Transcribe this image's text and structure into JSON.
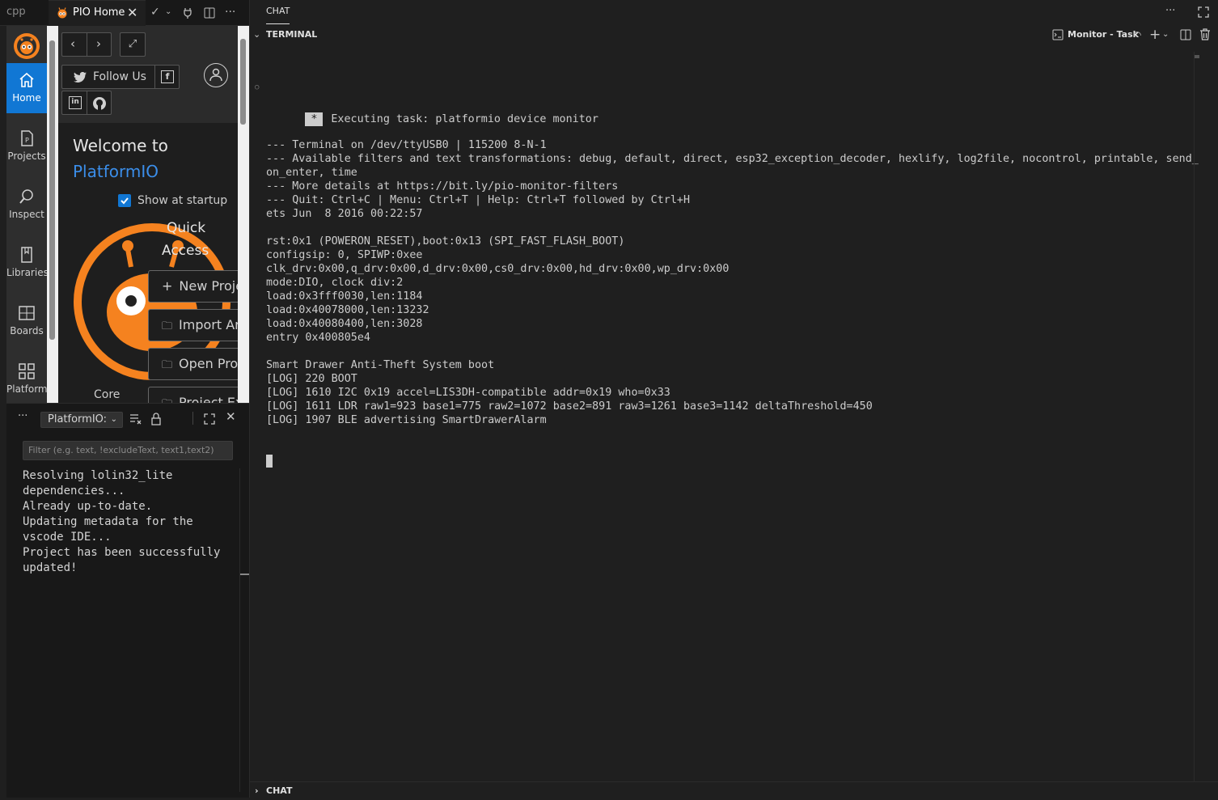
{
  "editor_tabs": {
    "inactive_label": "cpp",
    "active_label": "PIO Home"
  },
  "pio_home": {
    "sidebar": [
      {
        "label": "Home",
        "icon": "home-icon",
        "active": true
      },
      {
        "label": "Projects",
        "icon": "projects-icon"
      },
      {
        "label": "Inspect",
        "icon": "inspect-icon"
      },
      {
        "label": "Libraries",
        "icon": "libraries-icon"
      },
      {
        "label": "Boards",
        "icon": "boards-icon"
      },
      {
        "label": "Platforms",
        "icon": "platforms-icon"
      }
    ],
    "follow_label": "Follow Us",
    "welcome_line1": "Welcome to",
    "welcome_line2": "PlatformIO",
    "show_at_startup": "Show at startup",
    "quick_access_line1": "Quick",
    "quick_access_line2": "Access",
    "quick_buttons": [
      "New Proje",
      "Import Ard",
      "Open Proj",
      "Project Ex"
    ],
    "core_label": "Core",
    "colors": {
      "accent": "#1177d4",
      "link": "#3b8eea",
      "brand_orange": "#f5821f"
    }
  },
  "output": {
    "channel": "PlatformIO:",
    "filter_placeholder": "Filter (e.g. text, !excludeText, text1,text2)",
    "text": "Resolving lolin32_lite\ndependencies...\nAlready up-to-date.\nUpdating metadata for the\nvscode IDE...\nProject has been successfully\nupdated!"
  },
  "panel": {
    "chat_tab": "CHAT",
    "terminal_title": "TERMINAL",
    "task_label": "Monitor - Task",
    "chat_bottom": "CHAT"
  },
  "terminal": {
    "task_line": "Executing task: platformio device monitor",
    "lines": [
      "",
      "--- Terminal on /dev/ttyUSB0 | 115200 8-N-1",
      "--- Available filters and text transformations: debug, default, direct, esp32_exception_decoder, hexlify, log2file, nocontrol, printable, send_",
      "on_enter, time",
      "--- More details at https://bit.ly/pio-monitor-filters",
      "--- Quit: Ctrl+C | Menu: Ctrl+T | Help: Ctrl+T followed by Ctrl+H",
      "ets Jun  8 2016 00:22:57",
      "",
      "rst:0x1 (POWERON_RESET),boot:0x13 (SPI_FAST_FLASH_BOOT)",
      "configsip: 0, SPIWP:0xee",
      "clk_drv:0x00,q_drv:0x00,d_drv:0x00,cs0_drv:0x00,hd_drv:0x00,wp_drv:0x00",
      "mode:DIO, clock div:2",
      "load:0x3fff0030,len:1184",
      "load:0x40078000,len:13232",
      "load:0x40080400,len:3028",
      "entry 0x400805e4",
      "",
      "Smart Drawer Anti-Theft System boot",
      "[LOG] 220 BOOT",
      "[LOG] 1610 I2C 0x19 accel=LIS3DH-compatible addr=0x19 who=0x33",
      "[LOG] 1611 LDR raw1=923 base1=775 raw2=1072 base2=891 raw3=1261 base3=1142 deltaThreshold=450",
      "[LOG] 1907 BLE advertising SmartDrawerAlarm"
    ]
  }
}
